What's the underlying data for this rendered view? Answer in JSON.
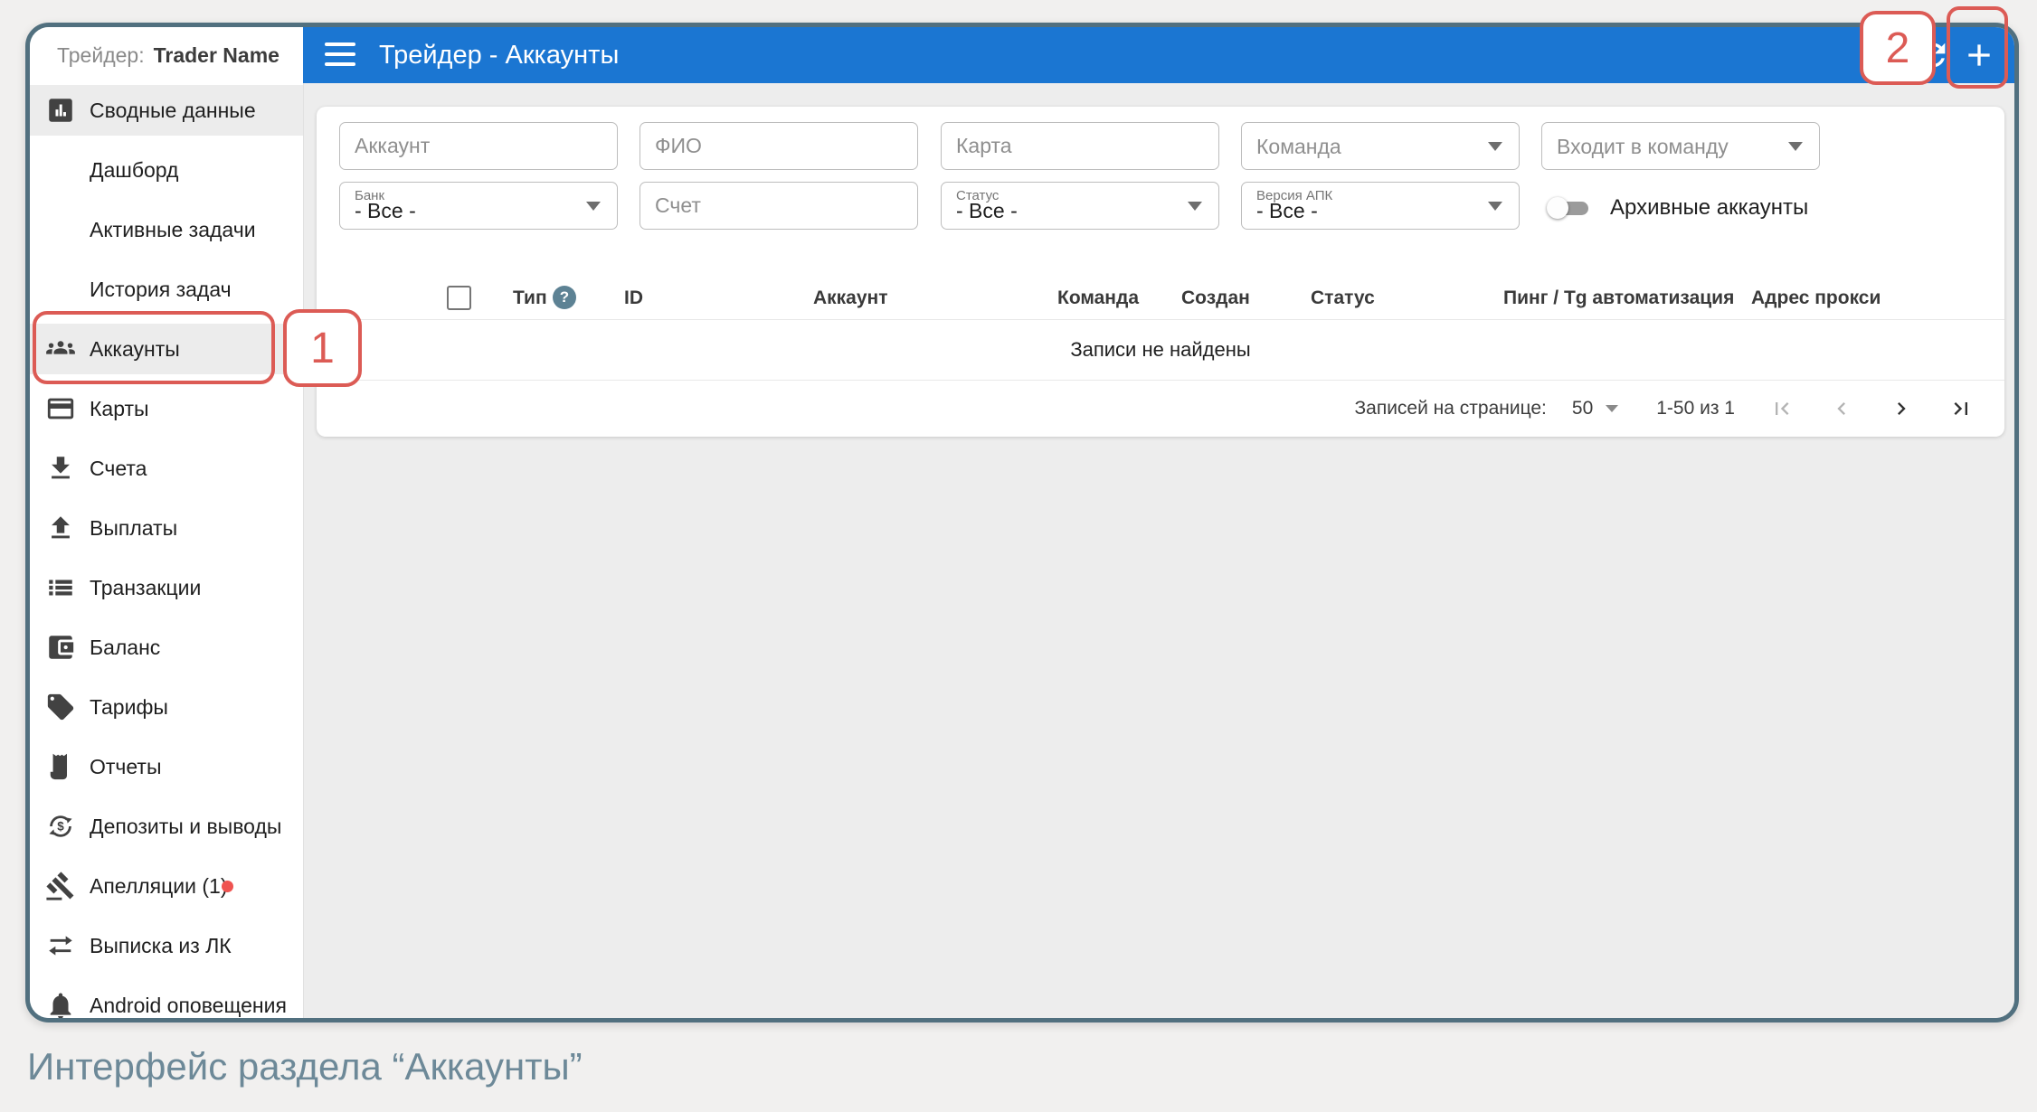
{
  "colors": {
    "accent_blue": "#1b76d2",
    "callout_red": "#dc5b55",
    "badge_red": "#ef5350",
    "help_icon": "#5d8294"
  },
  "topbar": {
    "title": "Трейдер - Аккаунты"
  },
  "sidebar": {
    "header_label": "Трейдер:",
    "header_value": "Trader Name",
    "items": [
      {
        "label": "Сводные данные"
      },
      {
        "label": "Дашборд"
      },
      {
        "label": "Активные задачи"
      },
      {
        "label": "История задач"
      },
      {
        "label": "Аккаунты"
      },
      {
        "label": "Карты"
      },
      {
        "label": "Счета"
      },
      {
        "label": "Выплаты"
      },
      {
        "label": "Транзакции"
      },
      {
        "label": "Баланс"
      },
      {
        "label": "Тарифы"
      },
      {
        "label": "Отчеты"
      },
      {
        "label": "Депозиты и выводы"
      },
      {
        "label": "Апелляции (1)"
      },
      {
        "label": "Выписка из ЛК"
      },
      {
        "label": "Android оповещения"
      }
    ]
  },
  "filters": {
    "account_placeholder": "Аккаунт",
    "fio_placeholder": "ФИО",
    "card_placeholder": "Карта",
    "team_placeholder": "Команда",
    "in_team_placeholder": "Входит в команду",
    "bank_label": "Банк",
    "bank_value": "- Все -",
    "invoice_placeholder": "Счет",
    "status_label": "Статус",
    "status_value": "- Все -",
    "apk_label": "Версия АПК",
    "apk_value": "- Все -",
    "archived_toggle_label": "Архивные аккаунты"
  },
  "table": {
    "headers": {
      "type": "Тип",
      "help": "?",
      "id": "ID",
      "account": "Аккаунт",
      "team": "Команда",
      "created": "Создан",
      "status": "Статус",
      "ping": "Пинг / Tg автоматизация",
      "proxy": "Адрес прокси"
    },
    "empty_text": "Записи не найдены"
  },
  "pagination": {
    "rows_label": "Записей на странице:",
    "rows_value": "50",
    "range": "1-50 из 1"
  },
  "callouts": {
    "step1": "1",
    "step2": "2"
  },
  "caption": {
    "text": "Интерфейс раздела “Аккаунты”"
  }
}
